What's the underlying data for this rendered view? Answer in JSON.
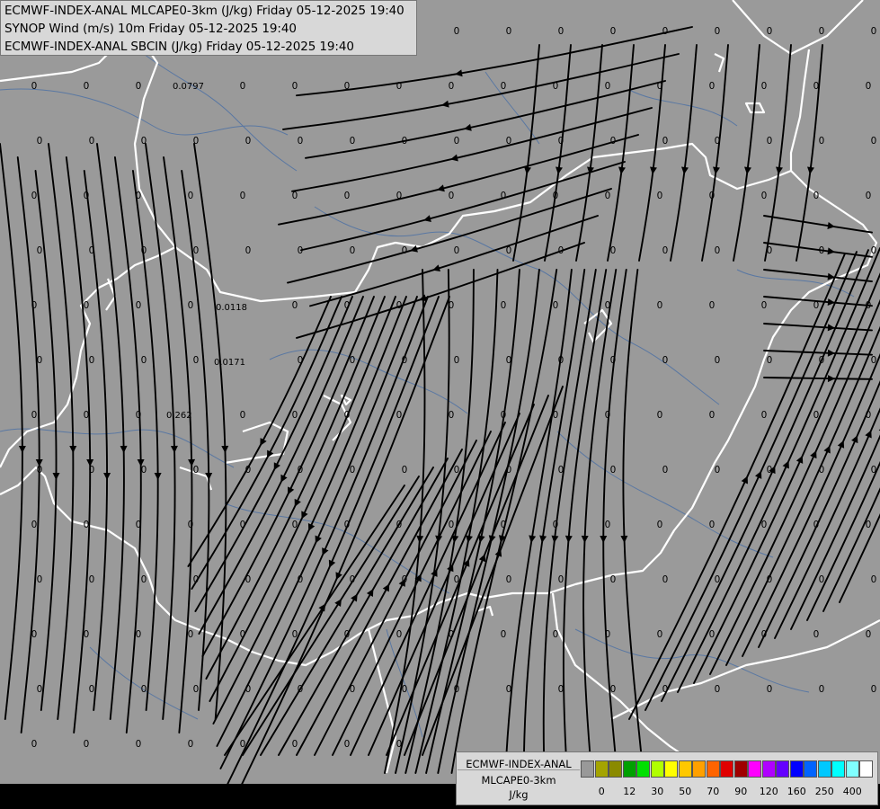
{
  "header": {
    "lines": [
      "ECMWF-INDEX-ANAL MLCAPE0-3km (J/kg) Friday 05-12-2025 19:40",
      "SYNOP Wind (m/s) 10m Friday 05-12-2025 19:40",
      "ECMWF-INDEX-ANAL SBCIN (J/kg) Friday 05-12-2025 19:40"
    ]
  },
  "map": {
    "background_color": "#9a9a9a",
    "border_color": "#ffffff",
    "river_color": "#4a6fa5",
    "streamline_color": "#000000",
    "notable_values": [
      "0.0797",
      "0.0118",
      "0.0171",
      "0.262"
    ]
  },
  "legend": {
    "title_line1": "ECMWF-INDEX-ANAL",
    "title_line2": "MLCAPE0-3km",
    "unit": "J/kg",
    "swatch_colors": [
      "#999999",
      "#a4a400",
      "#8a8a00",
      "#00a000",
      "#00e000",
      "#b0ff00",
      "#ffff00",
      "#ffc800",
      "#ffa000",
      "#ff6400",
      "#e00000",
      "#a00000",
      "#ff00ff",
      "#b000ff",
      "#6400ff",
      "#0000ff",
      "#0064ff",
      "#00c8ff",
      "#00ffff",
      "#80ffff",
      "#ffffff"
    ],
    "tick_labels": [
      "0",
      "12",
      "30",
      "50",
      "70",
      "90",
      "120",
      "160",
      "250",
      "400"
    ]
  }
}
